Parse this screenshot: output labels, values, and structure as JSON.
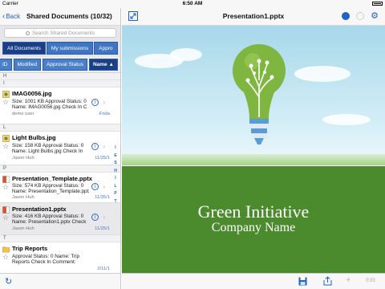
{
  "status": {
    "carrier": "Carrier",
    "time": "6:50 AM"
  },
  "left": {
    "back_label": "Back",
    "title": "Shared Documents (10/32)",
    "search_placeholder": "Search Shared Documents",
    "segments": [
      "All Documents",
      "My submissions",
      "Appro"
    ],
    "sort_buttons": [
      "ID",
      "Modified",
      "Approval Status",
      "Name ▲"
    ],
    "sections": [
      "H",
      "I",
      "L",
      "P",
      "T"
    ],
    "rows": [
      {
        "name": "IMAG0056.jpg",
        "line1": "Size: 1001 KB Approval Status: 0",
        "line2": "Name: IMAG0056.jpg  Check In C",
        "user": "demo user",
        "date": "Frida",
        "icon": "image"
      },
      {
        "name": "Light Bulbs.jpg",
        "line1": "Size: 158 KB Approval Status: 0",
        "line2": "Name: Light Bulbs.jpg  Check In",
        "user": "Jason Huh",
        "date": "11/25/1",
        "icon": "image"
      },
      {
        "name": "Presentation_Template.pptx",
        "line1": "Size: 574 KB Approval Status: 0",
        "line2": "Name: Presentation_Template.pptx",
        "user": "Jason Huh",
        "date": "11/25/1",
        "icon": "pptx"
      },
      {
        "name": "Presentation1.pptx",
        "line1": "Size: 416 KB Approval Status: 0",
        "line2": "Name: Presentation1.pptx  Check",
        "user": "Jason Huh",
        "date": "11/25/1",
        "icon": "pptx"
      },
      {
        "name": "Trip Reports",
        "line1": "Approval Status: 0  Name: Trip",
        "line2": "Reports  Check In Comment:",
        "user": "",
        "date": "2/11/1",
        "icon": "folder"
      }
    ],
    "index_letters": [
      "I",
      "E",
      "S",
      "H",
      "I",
      "L",
      "P",
      "T"
    ]
  },
  "right": {
    "title": "Presentation1.pptx",
    "slide_title": "Green Initiative",
    "slide_subtitle": "Company Name",
    "edit_label": "Edit"
  },
  "icons": [
    "back-chevron-icon",
    "search-icon",
    "refresh-icon",
    "expand-icon",
    "globe-icon",
    "spinner-icon",
    "gear-icon",
    "save-icon",
    "share-icon",
    "add-icon",
    "info-icon",
    "star-icon"
  ],
  "colors": {
    "accent": "#1e62c8",
    "slide_green": "#4c8a2e",
    "segment_blue": "#3f75c2"
  }
}
